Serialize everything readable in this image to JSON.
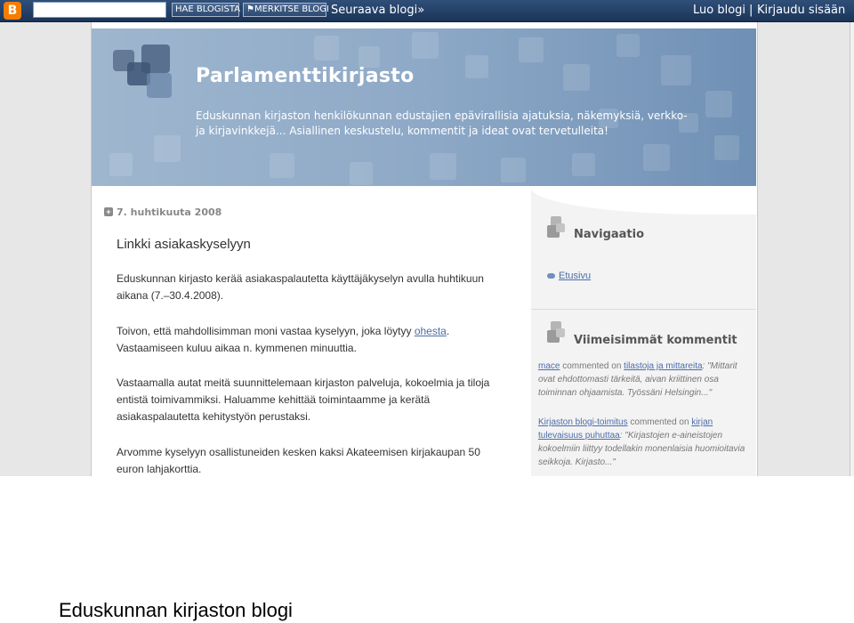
{
  "navbar": {
    "logo_letter": "B",
    "search_value": "",
    "search_blog_label": "HAE BLOGISTA",
    "flag_blog_label": "⚑MERKITSE BLOGI",
    "next_blog_label": "Seuraava blogi»",
    "create_blog_label": "Luo blogi",
    "separator": "|",
    "sign_in_label": "Kirjaudu sisään"
  },
  "header": {
    "title": "Parlamenttikirjasto",
    "description": "Eduskunnan kirjaston henkilökunnan edustajien epävirallisia ajatuksia, näkemyksiä, verkko- ja kirjavinkkejä... Asiallinen keskustelu, kommentit ja ideat ovat tervetulleita!"
  },
  "post": {
    "date": "7. huhtikuuta 2008",
    "title": "Linkki asiakaskyselyyn",
    "p1": "Eduskunnan kirjasto kerää asiakaspalautetta käyttäjäkyselyn avulla huhtikuun aikana (7.–30.4.2008).",
    "p2_before": "Toivon, että mahdollisimman moni vastaa kyselyyn, joka löytyy ",
    "p2_link": "ohesta",
    "p2_after": ". Vastaamiseen kuluu aikaa n. kymmenen minuuttia.",
    "p3": "Vastaamalla autat meitä suunnittelemaan kirjaston palveluja, kokoelmia ja tiloja entistä toimivammiksi. Haluamme kehittää toimintaamme ja kerätä asiakaspalautetta kehitystyön perustaksi.",
    "p4": "Arvomme kyselyyn osallistuneiden kesken kaksi Akateemisen kirjakaupan 50 euron lahjakorttia."
  },
  "sidebar": {
    "nav_heading": "Navigaatio",
    "nav_link": "Etusivu",
    "comments_heading": "Viimeisimmät kommentit",
    "comments": [
      {
        "author": "mace",
        "verb": " commented on ",
        "target": "tilastoja ja mittareita",
        "text": ": \"Mittarit ovat ehdottomasti tärkeitä, aivan kriittinen osa toiminnan ohjaamista. Työssäni Helsingin...\""
      },
      {
        "author": "Kirjaston blogi-toimitus",
        "verb": " commented on ",
        "target": "kirjan tulevaisuus puhuttaa",
        "text": ": \"Kirjastojen e-aineistojen kokoelmiin liittyy todellakin monenlaisia huomioitavia seikkoja. Kirjasto...\""
      }
    ]
  },
  "caption": "Eduskunnan kirjaston blogi",
  "colors": {
    "navbar": "#1b3458",
    "header_blue": "#8ea9c7",
    "link": "#4c6da8",
    "blogger_orange": "#f57d00"
  }
}
